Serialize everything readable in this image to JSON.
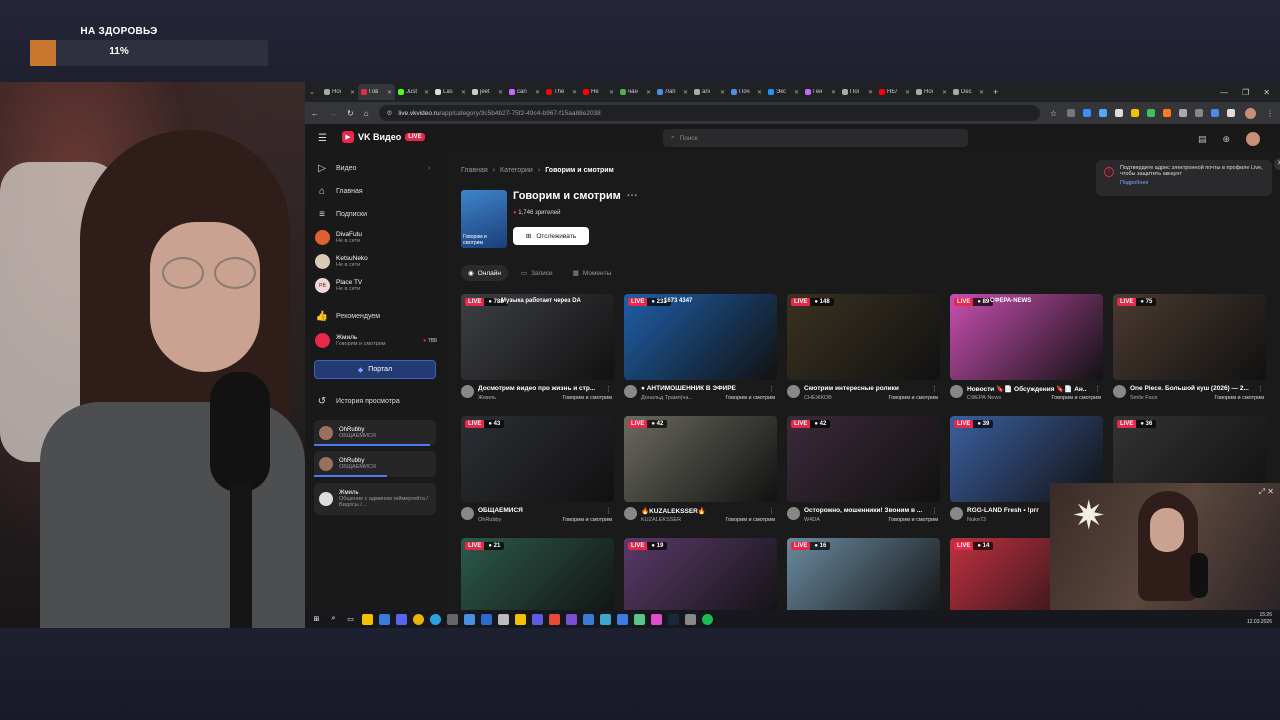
{
  "overlay": {
    "goal_title": "НА ЗДОРОВЬЭ",
    "goal_percent_text": "11%",
    "goal_progress": 0.11,
    "goal_color": "#c7782e"
  },
  "browser": {
    "tabs": [
      {
        "title": "Hoi",
        "color": "#aaa"
      },
      {
        "title": "Гов",
        "color": "#e8284a",
        "active": true
      },
      {
        "title": "Just",
        "color": "#53fc18"
      },
      {
        "title": "Las",
        "color": "#ddd"
      },
      {
        "title": "jeet",
        "color": "#ccc"
      },
      {
        "title": "can",
        "color": "#c36bff"
      },
      {
        "title": "The",
        "color": "#ff0000"
      },
      {
        "title": "He",
        "color": "#ff0000"
      },
      {
        "title": "чан",
        "color": "#4caf50"
      },
      {
        "title": "Лап",
        "color": "#4a90e2"
      },
      {
        "title": "ani",
        "color": "#aaa"
      },
      {
        "title": "Поч",
        "color": "#4a90e2"
      },
      {
        "title": "Экс",
        "color": "#2196f3"
      },
      {
        "title": "Ген",
        "color": "#c36bff"
      },
      {
        "title": "Поі",
        "color": "#aaa"
      },
      {
        "title": "НЕ/",
        "color": "#ff0000"
      },
      {
        "title": "Hoi",
        "color": "#aaa"
      },
      {
        "title": "Dec",
        "color": "#aaa"
      }
    ],
    "url_host": "live.vkvideo.ru",
    "url_path": "/app/category/3c5b4b27-75f2-49c4-b967-f15aa88e2038"
  },
  "app": {
    "logo_text": "VK Видео",
    "logo_badge": "LIVE",
    "search_placeholder": "Поиск"
  },
  "sidebar": {
    "nav": [
      {
        "label": "Видео",
        "icon": "play-icon"
      },
      {
        "label": "Главная",
        "icon": "home-icon"
      },
      {
        "label": "Подписки",
        "icon": "subscriptions-icon"
      }
    ],
    "channels": [
      {
        "name": "DivaFutu",
        "status": "Не в сети",
        "color": "#e06030"
      },
      {
        "name": "KetsuNeko",
        "status": "Не в сети",
        "color": "#d9c9b8"
      },
      {
        "name": "Place TV",
        "status": "Не в сети",
        "color": "#f1d7d7",
        "initials": "PB"
      }
    ],
    "recommend_label": "Рекомендуем",
    "recommended": {
      "name": "Жмиль",
      "status": "Говорим и смотрим",
      "viewers": "789"
    },
    "portal_label": "Портал",
    "history_label": "История просмотра",
    "history": [
      {
        "name": "OhRubby",
        "status": "ОБЩАЕМИСЯ",
        "progress": 0.95
      },
      {
        "name": "OhRubby",
        "status": "ОБЩАЕМИСЯ",
        "progress": 0.6
      },
      {
        "name": "Жмиль",
        "status": "Общение с админом геймергейта / Видосы /...",
        "progress": 0
      }
    ]
  },
  "main": {
    "breadcrumb": [
      "Главная",
      "Категории",
      "Говорим и смотрим"
    ],
    "category_title": "Говорим и смотрим",
    "cover_text": "Говорим и смотрим",
    "viewers": "1,746 зрителей",
    "follow_label": "Отслеживать",
    "tabs": [
      "Онлайн",
      "Записи",
      "Моменты"
    ],
    "notice_text": "Подтвердите адрес электронной почты в профиле Live, чтобы защитить аккаунт",
    "notice_link": "Подробнее",
    "live_label": "LIVE",
    "streams": [
      {
        "viewers": "788",
        "title": "Досмотрим видео про жизнь и стр...",
        "author": "Жмиль",
        "category": "Говорим и смотрим",
        "thumb": "#3d3f44",
        "overlay": "Музыка работает через DA"
      },
      {
        "viewers": "233",
        "title": "● АНТИМОШЕННИК В ЭФИРЕ",
        "author": "Дональд Трамп(ча...",
        "category": "Говорим и смотрим",
        "thumb": "#1e5fa8",
        "overlay": "1673 4347"
      },
      {
        "viewers": "148",
        "title": "Смотрим интересные ролики",
        "author": "СНЕЖКОВ",
        "category": "Говорим и смотрим",
        "thumb": "#3a3221",
        "overlay": ""
      },
      {
        "viewers": "89",
        "title": "Новости 🔖📄 Обсуждения 🔖📄 Ан...",
        "author": "СФЕРА News",
        "category": "Говорим и смотрим",
        "thumb": "#c84fb0",
        "overlay": "СФЕРА-NEWS"
      },
      {
        "viewers": "75",
        "title": "One Piece. Большой куш (2026) — 2...",
        "author": "Smile Face",
        "category": "Говорим и смотрим",
        "thumb": "#4a3a30",
        "overlay": ""
      },
      {
        "viewers": "43",
        "title": "ОБЩАЕМИСЯ",
        "author": "OhRubby",
        "category": "Говорим и смотрим",
        "thumb": "#2c2e34",
        "overlay": ""
      },
      {
        "viewers": "42",
        "title": "🔥KUZALEKSSER🔥",
        "author": "KUZALEKSSER",
        "category": "Говорим и смотрим",
        "thumb": "#6a6a60",
        "overlay": ""
      },
      {
        "viewers": "42",
        "title": "Осторожно, мошенники! Звоним в ...",
        "author": "W4DA",
        "category": "Говорим и смотрим",
        "thumb": "#3b2a3a",
        "overlay": ""
      },
      {
        "viewers": "39",
        "title": "RGG-LAND Fresh • !ргг",
        "author": "Nuke73",
        "category": "Говорим и смотрим",
        "thumb": "#3b5fa0",
        "overlay": ""
      },
      {
        "viewers": "36",
        "title": "",
        "author": "",
        "category": "",
        "thumb": "#333",
        "overlay": ""
      },
      {
        "viewers": "21",
        "title": "",
        "author": "",
        "category": "",
        "thumb": "#2c5a4a",
        "overlay": ""
      },
      {
        "viewers": "19",
        "title": "",
        "author": "",
        "category": "",
        "thumb": "#5a3a6a",
        "overlay": ""
      },
      {
        "viewers": "16",
        "title": "",
        "author": "",
        "category": "",
        "thumb": "#6a8aa0",
        "overlay": ""
      },
      {
        "viewers": "14",
        "title": "",
        "author": "",
        "category": "",
        "thumb": "#c03040",
        "overlay": ""
      }
    ]
  },
  "taskbar": {
    "time": "15:26",
    "date": "12.03.2026"
  }
}
